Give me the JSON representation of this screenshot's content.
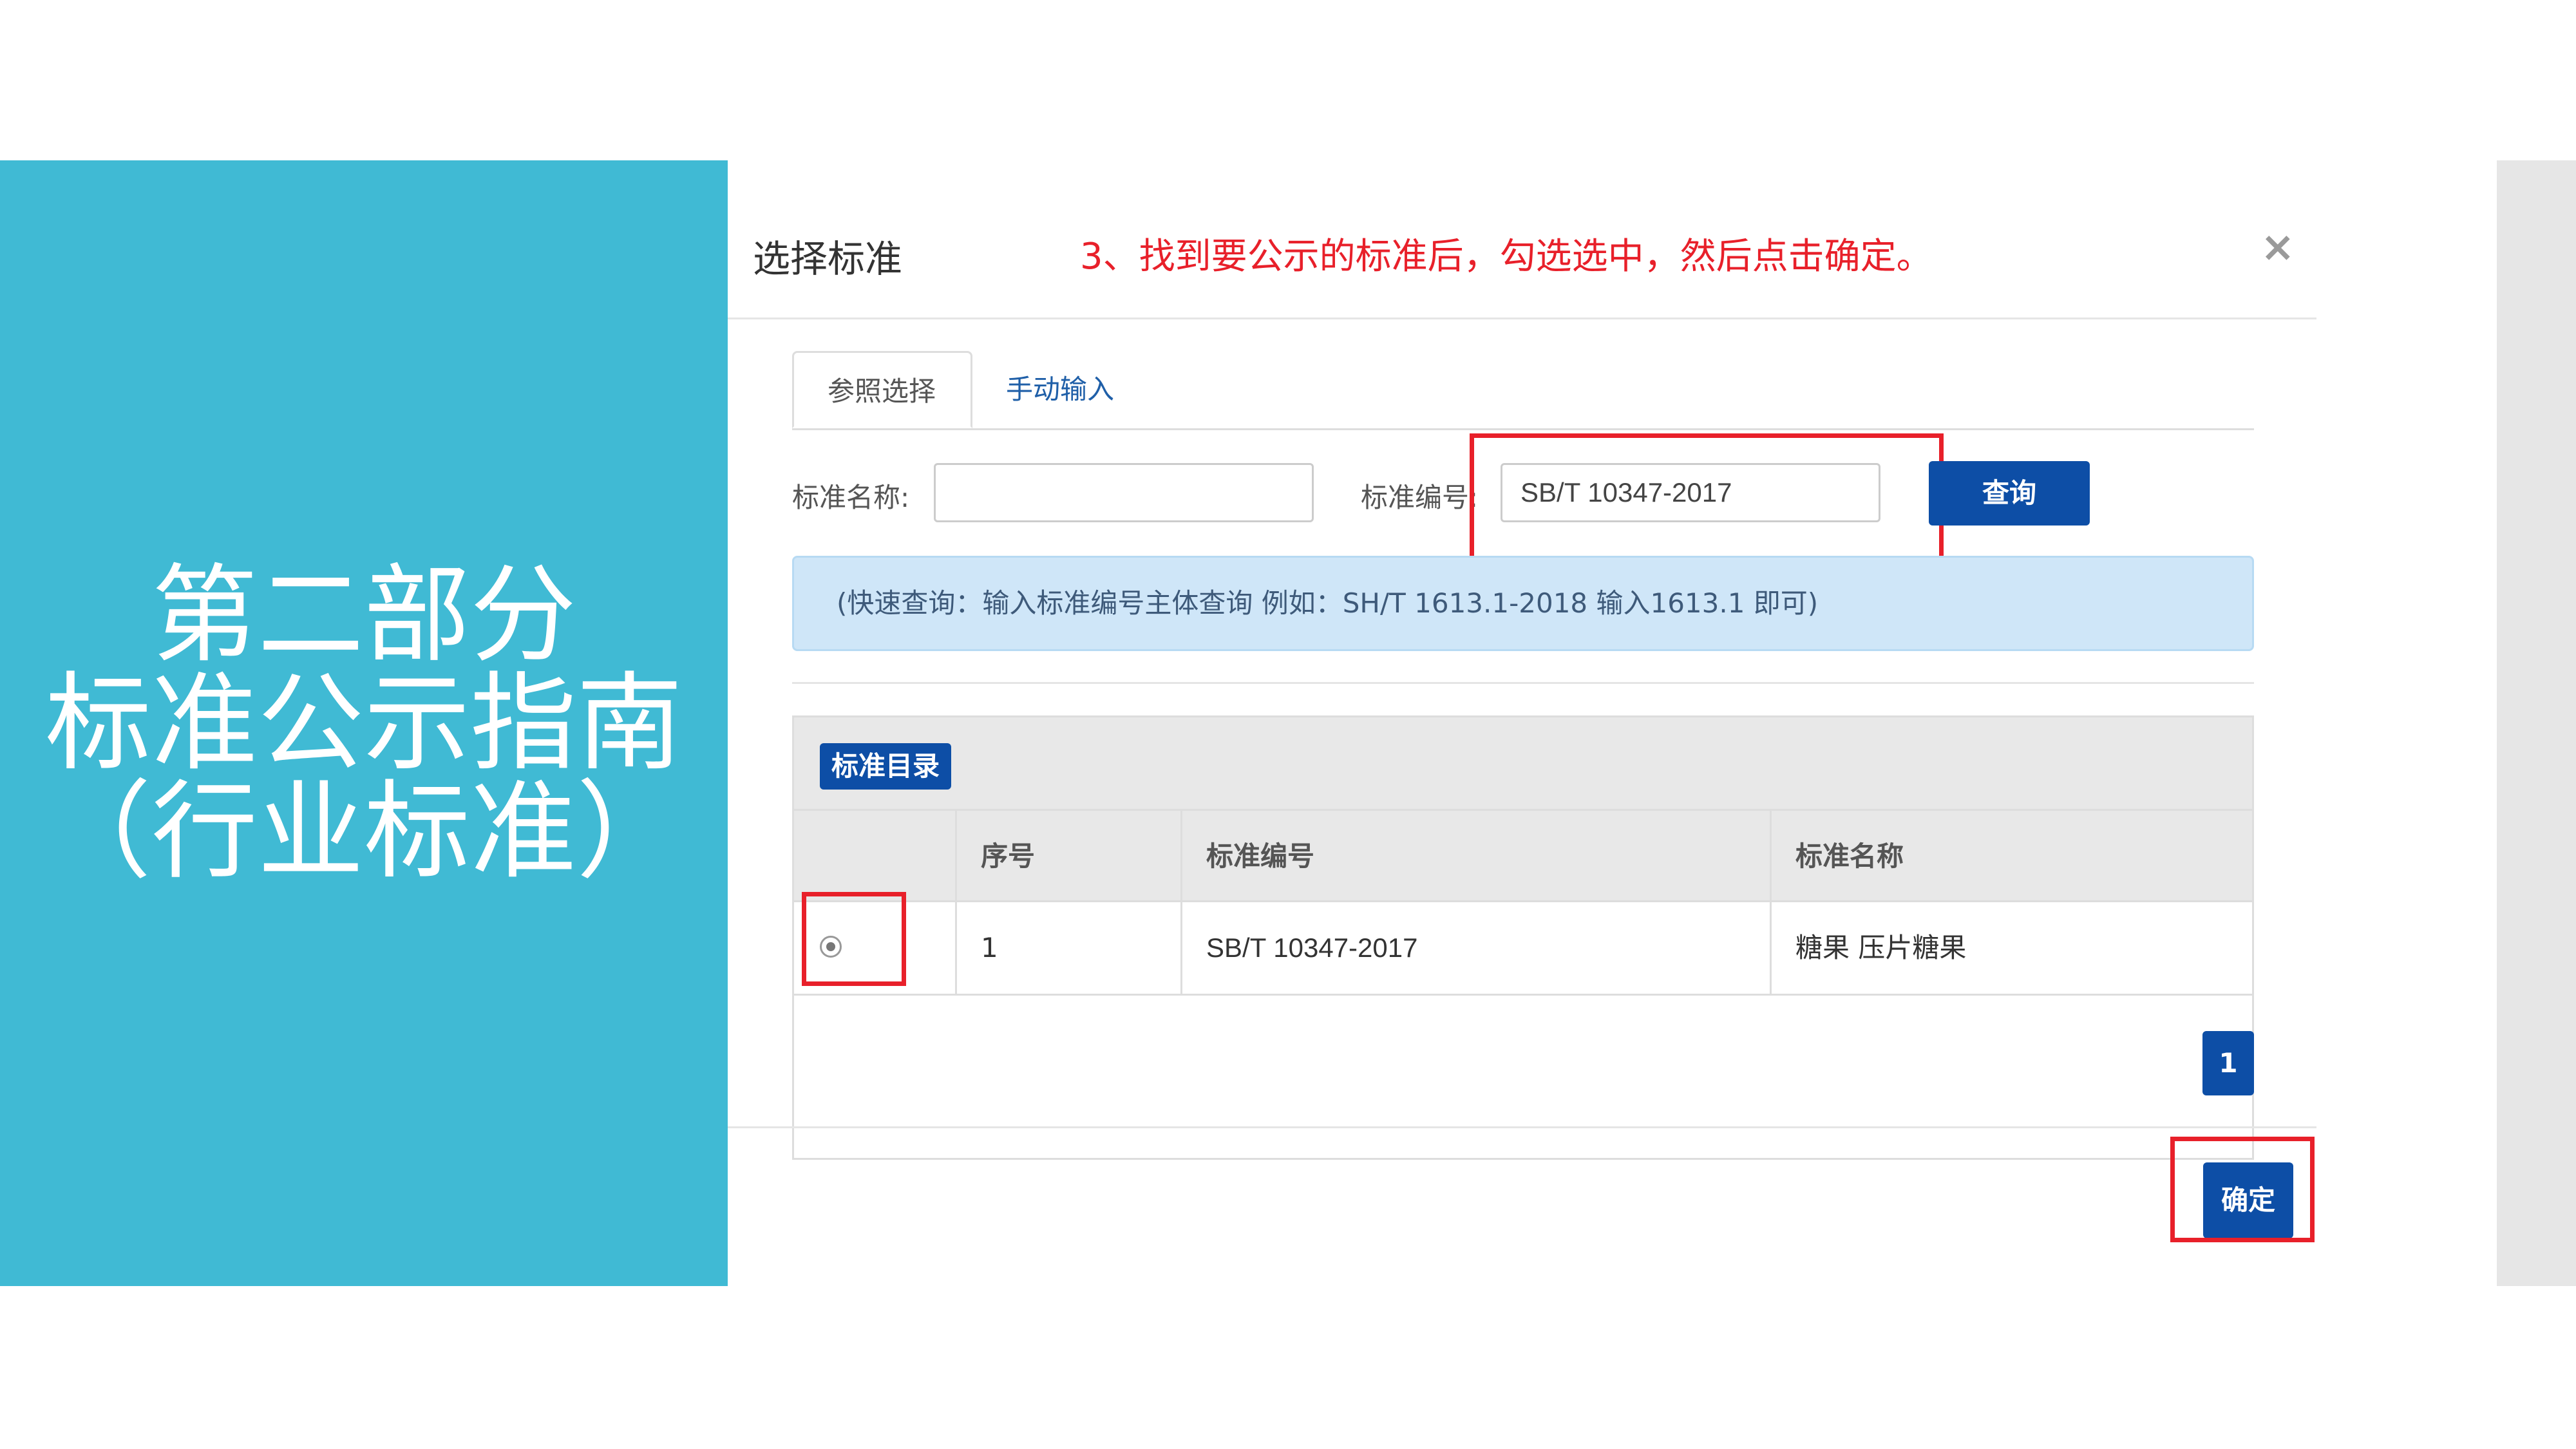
{
  "slide": {
    "title_lines": [
      "第二部分",
      "标准公示指南",
      "（行业标准）"
    ]
  },
  "modal": {
    "title": "选择标准",
    "instruction": "3、找到要公示的标准后，勾选选中，然后点击确定。",
    "close_glyph": "×",
    "tabs": [
      {
        "label": "参照选择",
        "active": true
      },
      {
        "label": "手动输入",
        "active": false
      }
    ],
    "search": {
      "name_label": "标准名称:",
      "name_value": "",
      "code_label": "标准编号:",
      "code_value": "SB/T 10347-2017",
      "query_button": "查询"
    },
    "hint": "(快速查询：输入标准编号主体查询 例如：SH/T 1613.1-2018 输入1613.1 即可)",
    "catalog": {
      "badge": "标准目录",
      "columns": [
        "序号",
        "标准编号",
        "标准名称"
      ],
      "rows": [
        {
          "index": "1",
          "code": "SB/T 10347-2017",
          "name": "糖果 压片糖果",
          "selected": true
        }
      ]
    },
    "pagination": {
      "current_page": "1"
    },
    "confirm_button": "确定"
  },
  "colors": {
    "accent": "#40bad4",
    "primary_button": "#0d4ea6",
    "highlight": "#e8202a"
  }
}
